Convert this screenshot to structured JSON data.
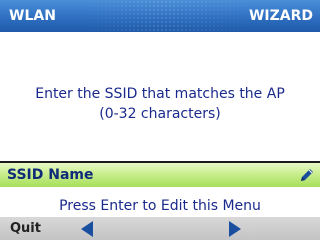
{
  "header": {
    "title_left": "WLAN",
    "title_right": "WIZARD"
  },
  "prompt": {
    "line1": "Enter the SSID that matches the AP",
    "line2": "(0-32 characters)"
  },
  "field": {
    "label": "SSID Name",
    "icon": "pencil-edit-icon"
  },
  "hint": "Press Enter to Edit this Menu",
  "softkeys": {
    "left_label": "Quit",
    "prev_icon": "left-arrow-icon",
    "next_icon": "right-arrow-icon"
  },
  "colors": {
    "title_bar": "#2f6fc1",
    "text": "#1a2a8c",
    "field_highlight": "#b8e673",
    "softkey_bar": "#cccccc",
    "arrow": "#1a4fa0"
  }
}
